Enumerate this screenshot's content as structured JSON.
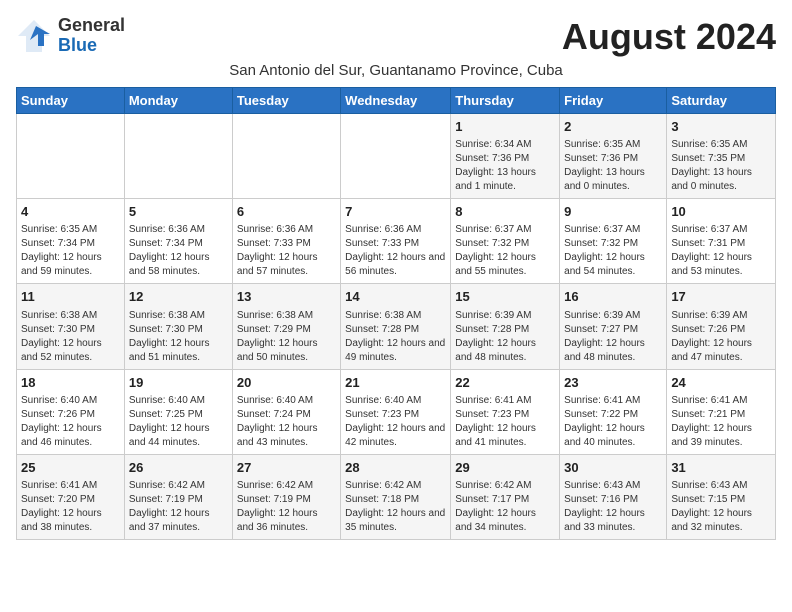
{
  "logo": {
    "general": "General",
    "blue": "Blue"
  },
  "title": "August 2024",
  "subtitle": "San Antonio del Sur, Guantanamo Province, Cuba",
  "days_of_week": [
    "Sunday",
    "Monday",
    "Tuesday",
    "Wednesday",
    "Thursday",
    "Friday",
    "Saturday"
  ],
  "weeks": [
    [
      {
        "day": "",
        "info": ""
      },
      {
        "day": "",
        "info": ""
      },
      {
        "day": "",
        "info": ""
      },
      {
        "day": "",
        "info": ""
      },
      {
        "day": "1",
        "info": "Sunrise: 6:34 AM\nSunset: 7:36 PM\nDaylight: 13 hours and 1 minute."
      },
      {
        "day": "2",
        "info": "Sunrise: 6:35 AM\nSunset: 7:36 PM\nDaylight: 13 hours and 0 minutes."
      },
      {
        "day": "3",
        "info": "Sunrise: 6:35 AM\nSunset: 7:35 PM\nDaylight: 13 hours and 0 minutes."
      }
    ],
    [
      {
        "day": "4",
        "info": "Sunrise: 6:35 AM\nSunset: 7:34 PM\nDaylight: 12 hours and 59 minutes."
      },
      {
        "day": "5",
        "info": "Sunrise: 6:36 AM\nSunset: 7:34 PM\nDaylight: 12 hours and 58 minutes."
      },
      {
        "day": "6",
        "info": "Sunrise: 6:36 AM\nSunset: 7:33 PM\nDaylight: 12 hours and 57 minutes."
      },
      {
        "day": "7",
        "info": "Sunrise: 6:36 AM\nSunset: 7:33 PM\nDaylight: 12 hours and 56 minutes."
      },
      {
        "day": "8",
        "info": "Sunrise: 6:37 AM\nSunset: 7:32 PM\nDaylight: 12 hours and 55 minutes."
      },
      {
        "day": "9",
        "info": "Sunrise: 6:37 AM\nSunset: 7:32 PM\nDaylight: 12 hours and 54 minutes."
      },
      {
        "day": "10",
        "info": "Sunrise: 6:37 AM\nSunset: 7:31 PM\nDaylight: 12 hours and 53 minutes."
      }
    ],
    [
      {
        "day": "11",
        "info": "Sunrise: 6:38 AM\nSunset: 7:30 PM\nDaylight: 12 hours and 52 minutes."
      },
      {
        "day": "12",
        "info": "Sunrise: 6:38 AM\nSunset: 7:30 PM\nDaylight: 12 hours and 51 minutes."
      },
      {
        "day": "13",
        "info": "Sunrise: 6:38 AM\nSunset: 7:29 PM\nDaylight: 12 hours and 50 minutes."
      },
      {
        "day": "14",
        "info": "Sunrise: 6:38 AM\nSunset: 7:28 PM\nDaylight: 12 hours and 49 minutes."
      },
      {
        "day": "15",
        "info": "Sunrise: 6:39 AM\nSunset: 7:28 PM\nDaylight: 12 hours and 48 minutes."
      },
      {
        "day": "16",
        "info": "Sunrise: 6:39 AM\nSunset: 7:27 PM\nDaylight: 12 hours and 48 minutes."
      },
      {
        "day": "17",
        "info": "Sunrise: 6:39 AM\nSunset: 7:26 PM\nDaylight: 12 hours and 47 minutes."
      }
    ],
    [
      {
        "day": "18",
        "info": "Sunrise: 6:40 AM\nSunset: 7:26 PM\nDaylight: 12 hours and 46 minutes."
      },
      {
        "day": "19",
        "info": "Sunrise: 6:40 AM\nSunset: 7:25 PM\nDaylight: 12 hours and 44 minutes."
      },
      {
        "day": "20",
        "info": "Sunrise: 6:40 AM\nSunset: 7:24 PM\nDaylight: 12 hours and 43 minutes."
      },
      {
        "day": "21",
        "info": "Sunrise: 6:40 AM\nSunset: 7:23 PM\nDaylight: 12 hours and 42 minutes."
      },
      {
        "day": "22",
        "info": "Sunrise: 6:41 AM\nSunset: 7:23 PM\nDaylight: 12 hours and 41 minutes."
      },
      {
        "day": "23",
        "info": "Sunrise: 6:41 AM\nSunset: 7:22 PM\nDaylight: 12 hours and 40 minutes."
      },
      {
        "day": "24",
        "info": "Sunrise: 6:41 AM\nSunset: 7:21 PM\nDaylight: 12 hours and 39 minutes."
      }
    ],
    [
      {
        "day": "25",
        "info": "Sunrise: 6:41 AM\nSunset: 7:20 PM\nDaylight: 12 hours and 38 minutes."
      },
      {
        "day": "26",
        "info": "Sunrise: 6:42 AM\nSunset: 7:19 PM\nDaylight: 12 hours and 37 minutes."
      },
      {
        "day": "27",
        "info": "Sunrise: 6:42 AM\nSunset: 7:19 PM\nDaylight: 12 hours and 36 minutes."
      },
      {
        "day": "28",
        "info": "Sunrise: 6:42 AM\nSunset: 7:18 PM\nDaylight: 12 hours and 35 minutes."
      },
      {
        "day": "29",
        "info": "Sunrise: 6:42 AM\nSunset: 7:17 PM\nDaylight: 12 hours and 34 minutes."
      },
      {
        "day": "30",
        "info": "Sunrise: 6:43 AM\nSunset: 7:16 PM\nDaylight: 12 hours and 33 minutes."
      },
      {
        "day": "31",
        "info": "Sunrise: 6:43 AM\nSunset: 7:15 PM\nDaylight: 12 hours and 32 minutes."
      }
    ]
  ]
}
